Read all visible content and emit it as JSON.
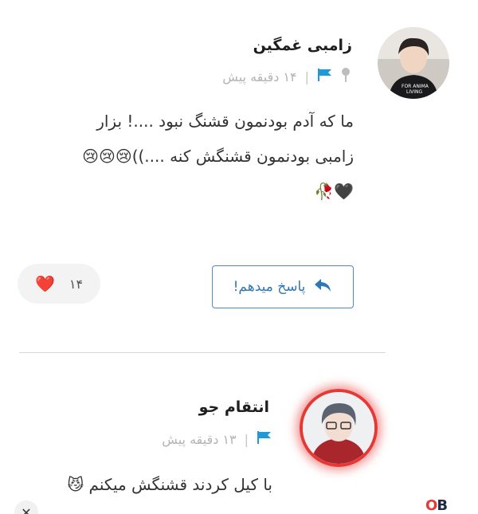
{
  "comments": [
    {
      "author": "زامبی غمگین",
      "time": "۱۴ دقیقه پیش",
      "separator": "|",
      "lines": [
        "ما که آدم بودنمون قشنگ نبود ....! بزار",
        "زامبی بودنمون قشنگش کنه ....))😢😢😢",
        "🖤🥀"
      ],
      "reply_label": "پاسخ میدهم!",
      "likes": "۱۴",
      "like_icon": "❤️"
    },
    {
      "author": "انتقام جو",
      "time": "۱۳ دقیقه پیش",
      "separator": "|",
      "lines": [
        "با کیل کردند قشنگش میکنم 😼"
      ]
    }
  ],
  "footer": {
    "close_icon": "✕",
    "brand_o": "O",
    "brand_b": "B"
  },
  "colors": {
    "accent": "#2f78b8",
    "flag": "#1e9ad6",
    "pin": "#bdbdbd",
    "avatar_ring": "#e53935"
  }
}
